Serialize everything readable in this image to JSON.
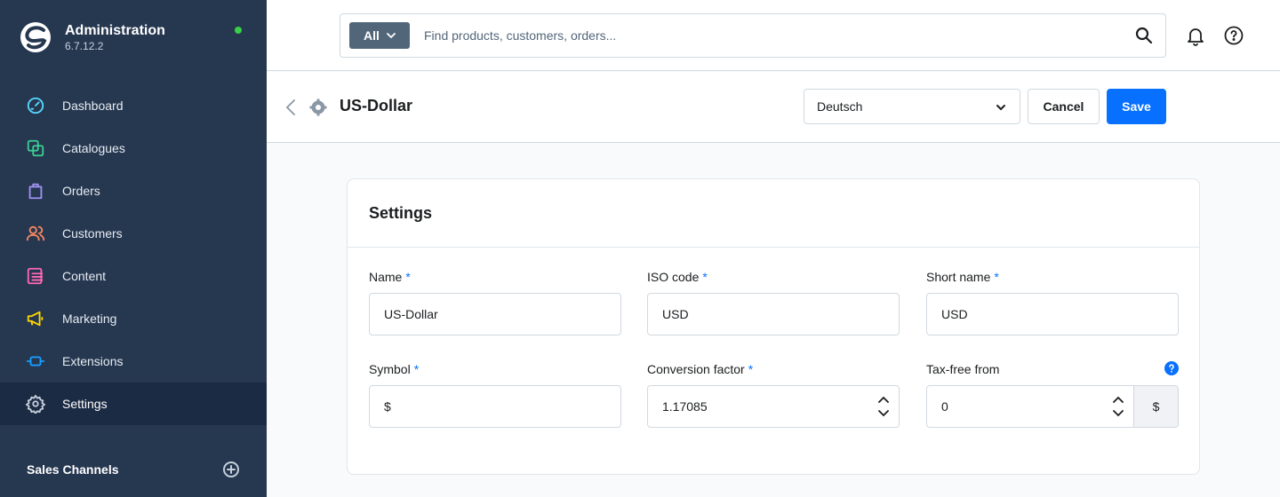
{
  "app": {
    "title": "Administration",
    "version": "6.7.12.2"
  },
  "sidebar": {
    "items": [
      {
        "label": "Dashboard",
        "icon": "dashboard-icon",
        "color": "#57d9ff"
      },
      {
        "label": "Catalogues",
        "icon": "catalogues-icon",
        "color": "#3bd092"
      },
      {
        "label": "Orders",
        "icon": "orders-icon",
        "color": "#a092f0"
      },
      {
        "label": "Customers",
        "icon": "customers-icon",
        "color": "#f88962"
      },
      {
        "label": "Content",
        "icon": "content-icon",
        "color": "#ff68b4"
      },
      {
        "label": "Marketing",
        "icon": "marketing-icon",
        "color": "#ffd700"
      },
      {
        "label": "Extensions",
        "icon": "extensions-icon",
        "color": "#189eff"
      },
      {
        "label": "Settings",
        "icon": "settings-icon",
        "color": "#c6d0dc"
      }
    ],
    "active_index": 7,
    "sales_channels_label": "Sales Channels"
  },
  "search": {
    "type_label": "All",
    "placeholder": "Find products, customers, orders..."
  },
  "smartbar": {
    "title": "US-Dollar",
    "language": "Deutsch",
    "cancel_label": "Cancel",
    "save_label": "Save"
  },
  "card": {
    "title": "Settings",
    "fields": {
      "name": {
        "label": "Name",
        "required": "*",
        "value": "US-Dollar"
      },
      "iso_code": {
        "label": "ISO code",
        "required": "*",
        "value": "USD"
      },
      "short_name": {
        "label": "Short name",
        "required": "*",
        "value": "USD"
      },
      "symbol": {
        "label": "Symbol",
        "required": "*",
        "value": "$"
      },
      "conversion_factor": {
        "label": "Conversion factor",
        "required": "*",
        "value": "1.17085"
      },
      "tax_free_from": {
        "label": "Tax-free from",
        "value": "0",
        "suffix": "$"
      }
    }
  },
  "colors": {
    "sidebar_bg": "#263750",
    "accent": "#0870ff",
    "online": "#37d046"
  }
}
